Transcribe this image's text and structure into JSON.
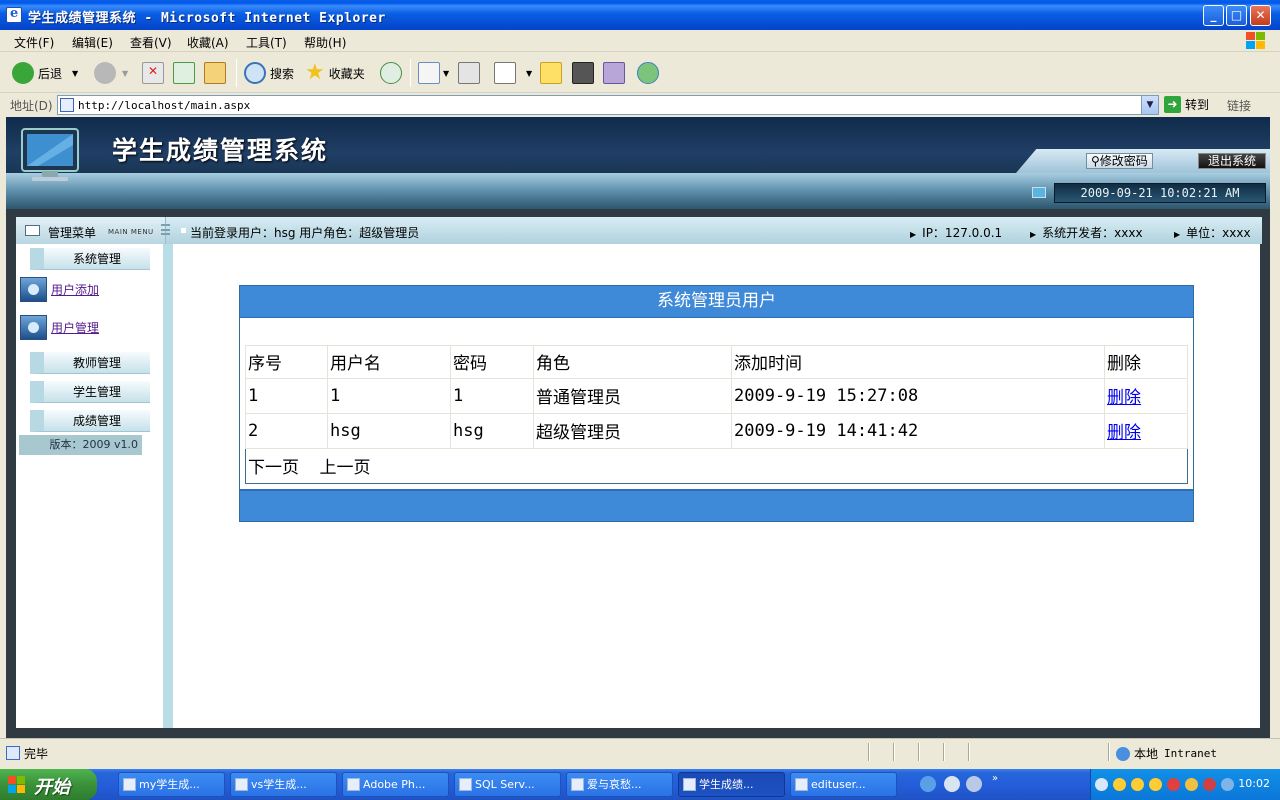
{
  "window": {
    "title": "学生成绩管理系统 - Microsoft Internet Explorer"
  },
  "menubar": {
    "items": [
      "文件(F)",
      "编辑(E)",
      "查看(V)",
      "收藏(A)",
      "工具(T)",
      "帮助(H)"
    ]
  },
  "toolbar": {
    "back_label": "后退",
    "search_label": "搜索",
    "favorites_label": "收藏夹"
  },
  "address": {
    "label": "地址(D)",
    "url": "http://localhost/main.aspx",
    "go_label": "转到",
    "links_label": "链接"
  },
  "app": {
    "title": "学生成绩管理系统",
    "change_password": "修改密码",
    "logout": "退出系统",
    "datetime": "2009-09-21 10:02:21 AM"
  },
  "infobar": {
    "menu_label": "管理菜单",
    "menu_en": "MAIN MENU",
    "user_info": "当前登录用户：hsg  用户角色：超级管理员",
    "ip": "IP：127.0.0.1",
    "developer": "系统开发者：xxxx",
    "unit": "单位：xxxx"
  },
  "leftmenu": {
    "system_mgmt": "系统管理",
    "user_add": "用户添加",
    "user_mgmt": "用户管理",
    "teacher_mgmt": "教师管理",
    "student_mgmt": "学生管理",
    "score_mgmt": "成绩管理",
    "version": "版本：2009 v1.0"
  },
  "panel": {
    "title": "系统管理员用户",
    "columns": [
      "序号",
      "用户名",
      "密码",
      "角色",
      "添加时间",
      "删除"
    ],
    "rows": [
      [
        "1",
        "1",
        "1",
        "普通管理员",
        "2009-9-19 15:27:08",
        "删除"
      ],
      [
        "2",
        "hsg",
        "hsg",
        "超级管理员",
        "2009-9-19 14:41:42",
        "删除"
      ]
    ],
    "next_page": "下一页",
    "prev_page": "上一页"
  },
  "statusbar": {
    "text": "完毕",
    "zone": "本地",
    "zone2": "Intranet"
  },
  "taskbar": {
    "start": "开始",
    "tasks": [
      "my学生成...",
      "vs学生成...",
      "Adobe Ph...",
      "SQL Serv...",
      "爱与哀愁...",
      "学生成绩...",
      "edituser..."
    ],
    "clock": "10:02"
  },
  "colors": {
    "header_blue": "#3f8ad8",
    "link": "#0000ee",
    "taskbar": "#245edb"
  }
}
